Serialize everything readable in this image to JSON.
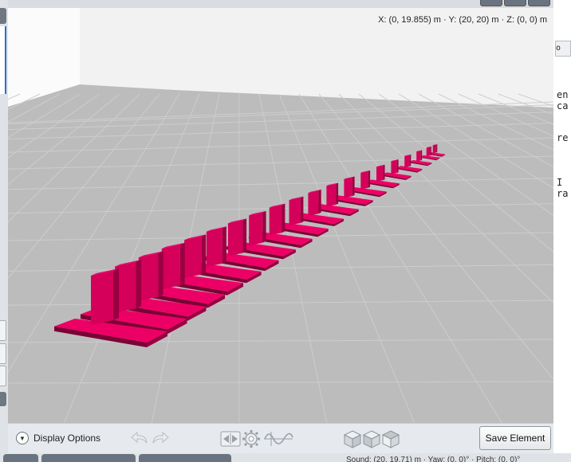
{
  "viewport": {
    "coordinates": "X: (0, 19.855) m  ·  Y: (20, 20) m  ·  Z: (0, 0) m",
    "floor_color": "#bcbcbc",
    "wall_color": "#f2f2f2",
    "element_color": "#d4005a",
    "element_count": 20
  },
  "toolbar": {
    "display_options_label": "Display Options",
    "save_label": "Save Element"
  },
  "console": {
    "lines": [
      "en",
      "ca",
      "",
      "re",
      "",
      "",
      "I",
      "ra"
    ]
  },
  "status": {
    "text": "Sound: (20, 19.71) m · Yaw: (0, 0)° · Pitch: (0, 0)°"
  },
  "icons": {
    "display_options": "chevron-down-icon",
    "undo": "undo-icon",
    "redo": "redo-icon",
    "mirror": "mirror-icon",
    "gear": "gear-icon",
    "wave": "sine-wave-icon",
    "cube": "cube-view-icon"
  }
}
